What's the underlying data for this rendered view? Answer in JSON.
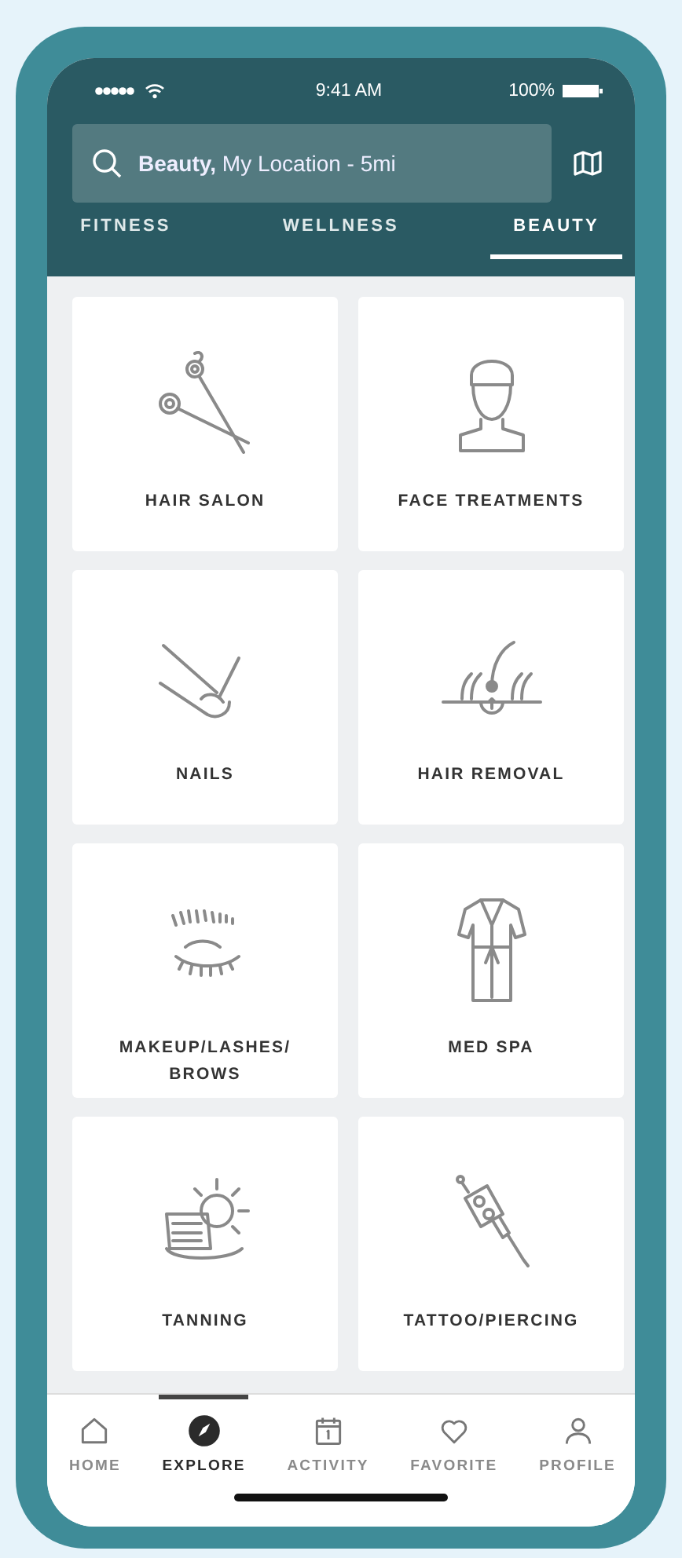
{
  "status_bar": {
    "time": "9:41 AM",
    "battery": "100%"
  },
  "search": {
    "value": "**Beauty,** My Location - 5mi"
  },
  "tabs": [
    {
      "label": "FITNESS",
      "selected": false
    },
    {
      "label": "WELLNESS",
      "selected": false
    },
    {
      "label": "BEAUTY",
      "selected": true
    }
  ],
  "categories": [
    {
      "label": "HAIR SALON"
    },
    {
      "label": "FACE TREATMENTS"
    },
    {
      "label": "NAILS"
    },
    {
      "label": "HAIR REMOVAL"
    },
    {
      "label": "MAKEUP/LASHES/ BROWS"
    },
    {
      "label": "MED SPA"
    },
    {
      "label": "TANNING"
    },
    {
      "label": "TATTOO/PIERCING"
    }
  ],
  "bottom_nav": [
    {
      "label": "HOME",
      "selected": false
    },
    {
      "label": "EXPLORE",
      "selected": true
    },
    {
      "label": "ACTIVITY",
      "selected": false
    },
    {
      "label": "FAVORITE",
      "selected": false
    },
    {
      "label": "PROFILE",
      "selected": false
    }
  ]
}
